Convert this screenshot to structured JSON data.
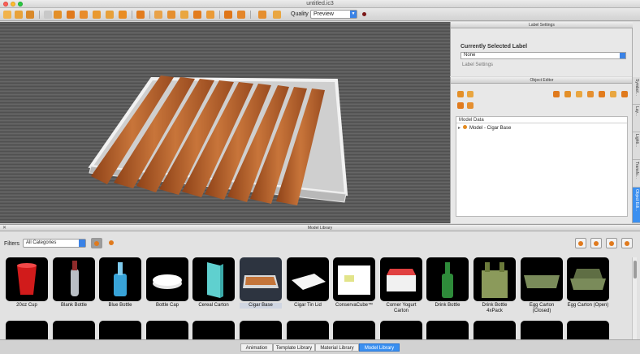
{
  "window": {
    "title": "untitled.ic3"
  },
  "toolbar": {
    "quality_label": "Quality",
    "quality_value": "Preview"
  },
  "label_settings": {
    "header": "Label Settings",
    "current_label_title": "Currently Selected Label",
    "current_label_value": "None",
    "sub_label": "Label Settings"
  },
  "object_editor": {
    "header": "Object Editor",
    "model_data_header": "Model Data",
    "tree_item": "Model - Cigar Base"
  },
  "side_tabs": [
    "Symbol...",
    "Lay...",
    "Lighti...",
    "Transfo...",
    "Object Edi..."
  ],
  "library": {
    "header": "Model Library",
    "filters_label": "Filters",
    "filter_value": "All Categories",
    "items": [
      {
        "label": "20oz Cup",
        "icon": "red-cup"
      },
      {
        "label": "Blank Bottle",
        "icon": "clear-bottle"
      },
      {
        "label": "Blue Bottle",
        "icon": "blue-bottle"
      },
      {
        "label": "Bottle Cap",
        "icon": "bottle-cap"
      },
      {
        "label": "Cereal Carton",
        "icon": "cereal-carton"
      },
      {
        "label": "Cigar Base",
        "icon": "cigar-tray"
      },
      {
        "label": "Cigar Tin Lid",
        "icon": "tin-lid"
      },
      {
        "label": "ConservaCube™",
        "icon": "conserva-cube"
      },
      {
        "label": "Corner Yogurt Carton",
        "icon": "yogurt-carton"
      },
      {
        "label": "Drink Bottle",
        "icon": "green-bottle"
      },
      {
        "label": "Drink Bottle 4xPack",
        "icon": "bottle-pack"
      },
      {
        "label": "Egg Carton (Closed)",
        "icon": "egg-carton-closed"
      },
      {
        "label": "Egg Carton (Open)",
        "icon": "egg-carton-open"
      }
    ]
  },
  "bottom_tabs": [
    "Animation",
    "Template Library",
    "Material Library",
    "Model Library"
  ],
  "colors": {
    "accent": "#3a8ff0",
    "toolbar_orange": "#e07a1d",
    "cigar": "#b4622c"
  }
}
